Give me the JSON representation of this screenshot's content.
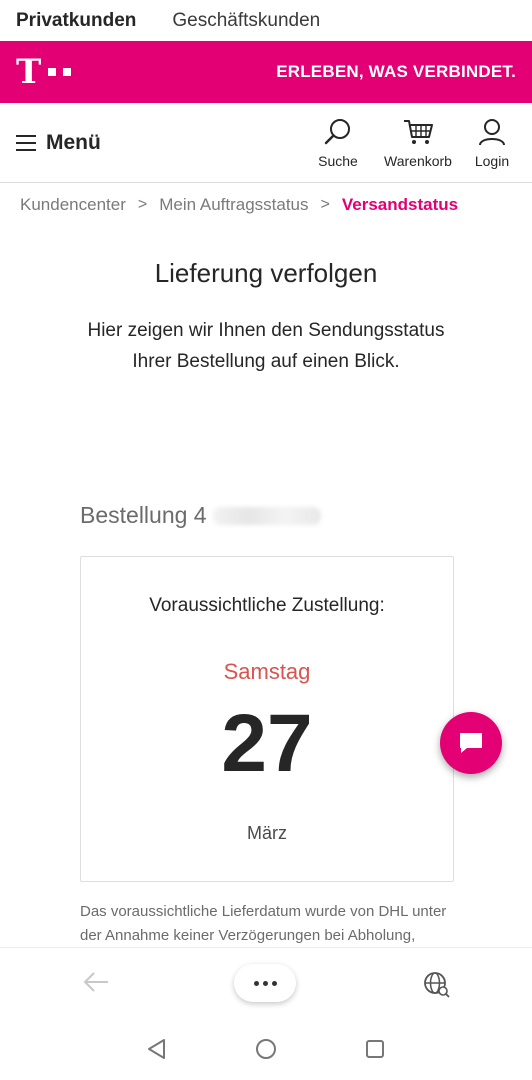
{
  "segments": {
    "active": "Privatkunden",
    "inactive": "Geschäftskunden"
  },
  "brand": {
    "claim": "ERLEBEN, WAS VERBINDET.",
    "logo_letter": "T",
    "accent": "#e20074"
  },
  "nav": {
    "menu_label": "Menü",
    "search_label": "Suche",
    "cart_label": "Warenkorb",
    "login_label": "Login"
  },
  "breadcrumb": {
    "items": [
      "Kundencenter",
      "Mein Auftragsstatus"
    ],
    "current": "Versandstatus",
    "separator": ">"
  },
  "page": {
    "title": "Lieferung verfolgen",
    "intro_line1": "Hier zeigen wir Ihnen den Sendungsstatus",
    "intro_line2": "Ihrer Bestellung auf einen Blick."
  },
  "order": {
    "label": "Bestellung 4"
  },
  "delivery": {
    "label": "Voraussichtliche Zustellung:",
    "weekday": "Samstag",
    "day": "27",
    "month": "März",
    "weekday_color": "#d9534f"
  },
  "note": {
    "line1": "Das voraussichtliche Lieferdatum wurde von DHL unter",
    "line2": "der Annahme keiner Verzögerungen bei Abholung,"
  }
}
